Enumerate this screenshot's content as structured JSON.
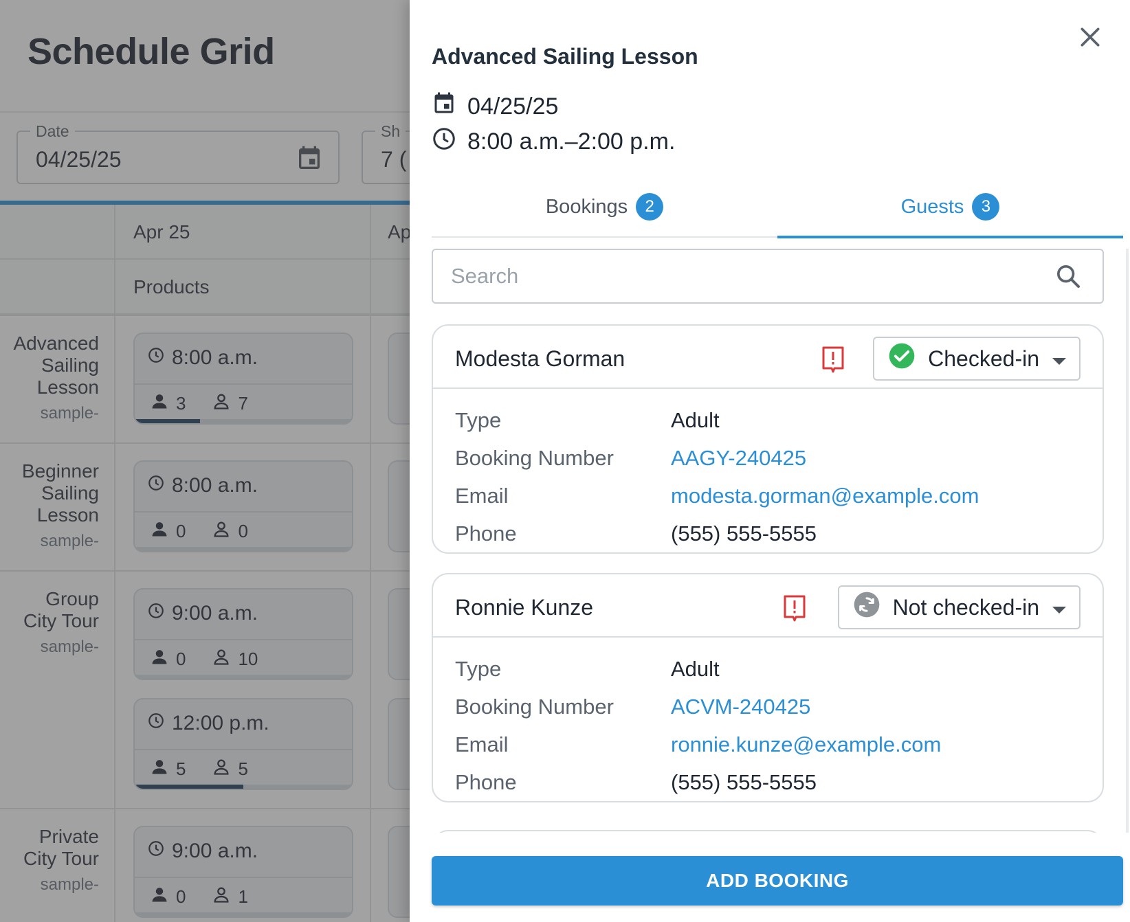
{
  "page": {
    "title": "Schedule Grid",
    "date_field": {
      "label": "Date",
      "value": "04/25/25"
    },
    "second_field": {
      "label": "Sh",
      "value": "7 ("
    }
  },
  "grid": {
    "date_headers": [
      "Apr 25",
      "Ap"
    ],
    "products_header": "Products",
    "rows": [
      {
        "name_lines": [
          "Advanced",
          "Sailing",
          "Lesson"
        ],
        "sub": "sample-",
        "slots": [
          {
            "time": "8:00 a.m.",
            "booked": "3",
            "available": "7",
            "fill": 0.3
          }
        ]
      },
      {
        "name_lines": [
          "Beginner",
          "Sailing",
          "Lesson"
        ],
        "sub": "sample-",
        "slots": [
          {
            "time": "8:00 a.m.",
            "booked": "0",
            "available": "0",
            "fill": 0
          }
        ]
      },
      {
        "name_lines": [
          "Group",
          "City Tour"
        ],
        "sub": "sample-",
        "slots": [
          {
            "time": "9:00 a.m.",
            "booked": "0",
            "available": "10",
            "fill": 0
          },
          {
            "time": "12:00 p.m.",
            "booked": "5",
            "available": "5",
            "fill": 0.5
          }
        ]
      },
      {
        "name_lines": [
          "Private",
          "City Tour"
        ],
        "sub": "sample-",
        "slots": [
          {
            "time": "9:00 a.m.",
            "booked": "0",
            "available": "1",
            "fill": 0
          }
        ]
      }
    ]
  },
  "drawer": {
    "title": "Advanced Sailing Lesson",
    "date": "04/25/25",
    "time": "8:00 a.m.–2:00 p.m.",
    "tabs": [
      {
        "label": "Bookings",
        "count": "2",
        "active": false
      },
      {
        "label": "Guests",
        "count": "3",
        "active": true
      }
    ],
    "search_placeholder": "Search",
    "field_labels": {
      "type": "Type",
      "booking": "Booking Number",
      "email": "Email",
      "phone": "Phone"
    },
    "guests": [
      {
        "name": "Modesta Gorman",
        "status": "Checked-in",
        "status_icon": "check-circle-icon",
        "type": "Adult",
        "booking_number": "AAGY-240425",
        "email": "modesta.gorman@example.com",
        "phone": "(555) 555-5555"
      },
      {
        "name": "Ronnie Kunze",
        "status": "Not checked-in",
        "status_icon": "sync-icon",
        "type": "Adult",
        "booking_number": "ACVM-240425",
        "email": "ronnie.kunze@example.com",
        "phone": "(555) 555-5555"
      }
    ],
    "add_button": "ADD BOOKING"
  },
  "colors": {
    "accent": "#2b8fd6",
    "checked_in": "#34b65a",
    "not_checked_in": "#8f9499",
    "alert": "#d93a3a",
    "scrim": "rgba(70,70,70,0.5)"
  }
}
